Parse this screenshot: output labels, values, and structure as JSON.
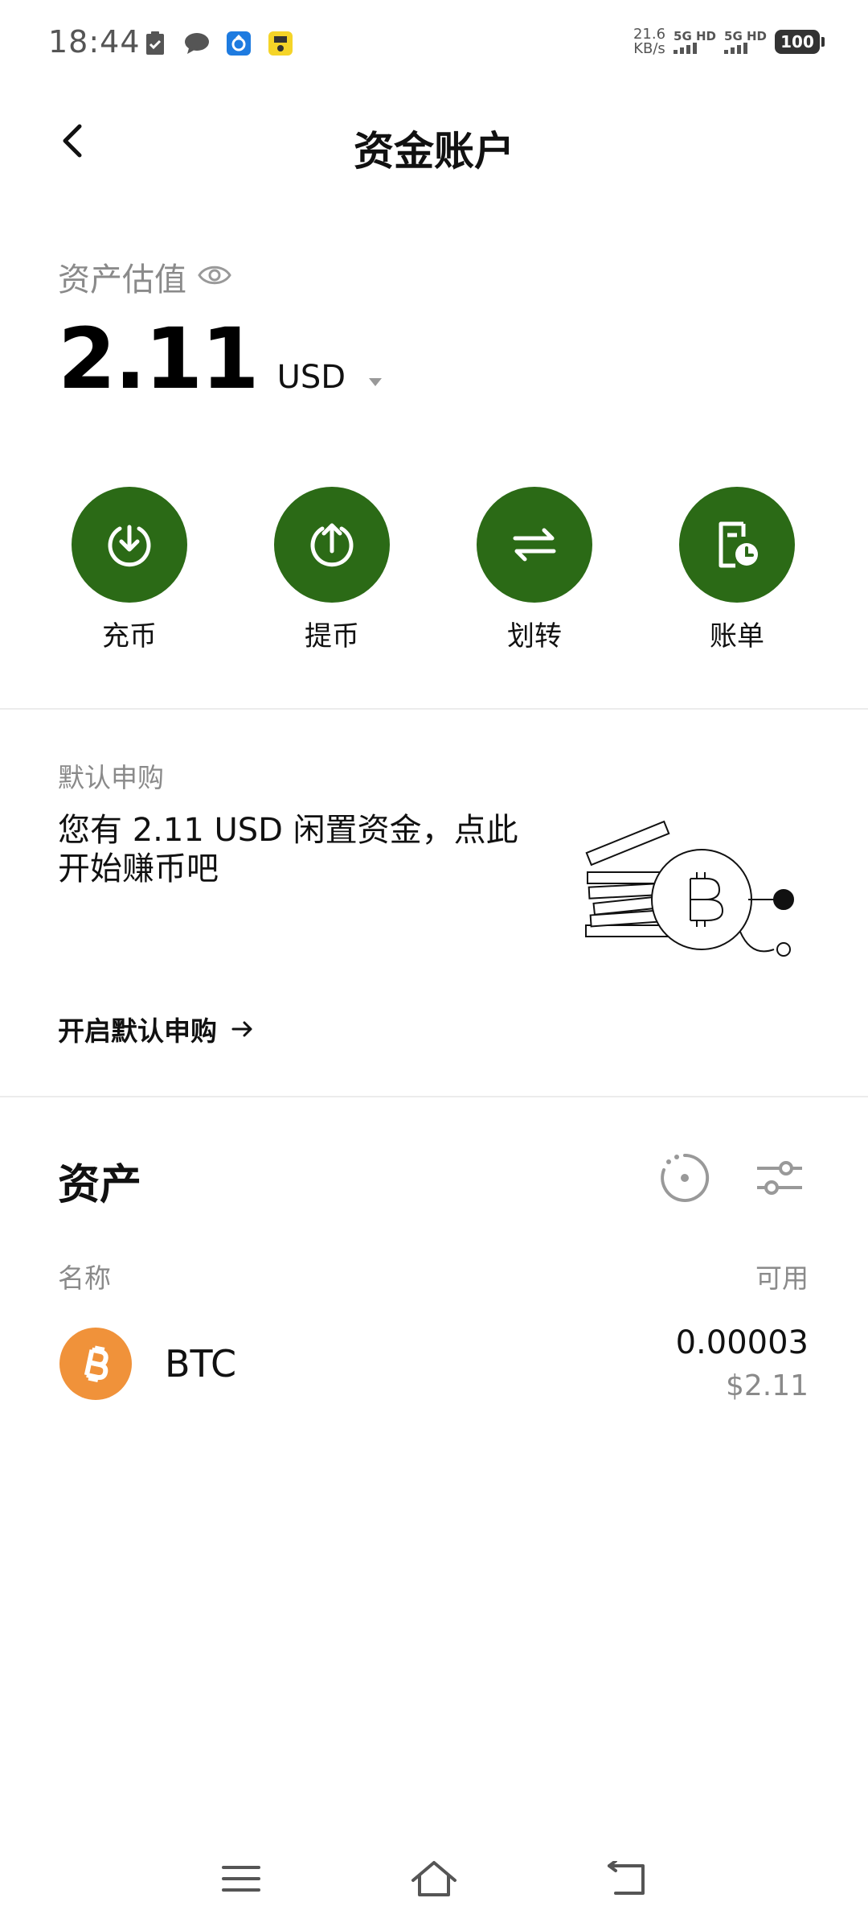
{
  "status_bar": {
    "time": "18:44",
    "net_speed_value": "21.6",
    "net_speed_unit": "KB/s",
    "sim1": "5G HD",
    "sim2": "5G HD",
    "battery": "100",
    "colors": {
      "text": "#555555"
    }
  },
  "header": {
    "title": "资金账户",
    "back_icon": "chevron-left-icon"
  },
  "asset_summary": {
    "label": "资产估值",
    "visibility_icon": "eye-icon",
    "value": "2.11",
    "currency": "USD"
  },
  "actions": [
    {
      "label": "充币",
      "icon": "deposit-icon"
    },
    {
      "label": "提币",
      "icon": "withdraw-icon"
    },
    {
      "label": "划转",
      "icon": "transfer-icon"
    },
    {
      "label": "账单",
      "icon": "bill-icon"
    }
  ],
  "promo": {
    "label": "默认申购",
    "text": "您有 2.11 USD 闲置资金，点此开始赚币吧",
    "link": "开启默认申购"
  },
  "assets": {
    "title": "资产",
    "col_name": "名称",
    "col_available": "可用",
    "items": [
      {
        "symbol": "BTC",
        "amount": "0.00003",
        "usd_value": "$2.11",
        "icon": "bitcoin-icon"
      }
    ]
  },
  "colors": {
    "primary": "#2b6a16",
    "muted": "#8a8a8a",
    "btc": "#f0923a"
  }
}
